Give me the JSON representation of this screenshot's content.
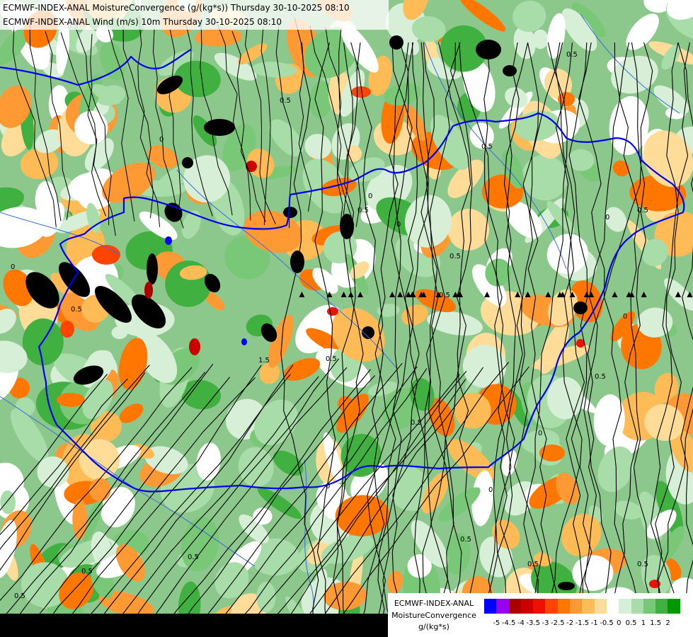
{
  "header": {
    "line1": "ECMWF-INDEX-ANAL MoistureConvergence (g/(kg*s)) Thursday 30-10-2025 08:10",
    "line2": "ECMWF-INDEX-ANAL Wind (m/s) 10m Thursday 30-10-2025 08:10"
  },
  "legend": {
    "line1": "ECMWF-INDEX-ANAL",
    "line2": "MoistureConvergence",
    "line3": "g/(kg*s)",
    "colors": [
      "#0000ff",
      "#9900ee",
      "#aa0000",
      "#cc0000",
      "#ee1100",
      "#ff4400",
      "#ff7700",
      "#ff9933",
      "#ffbb55",
      "#ffdd99",
      "#ffffff",
      "#d6efd6",
      "#a8dca8",
      "#78c878",
      "#40b040",
      "#009900"
    ],
    "ticks": [
      "-5",
      "-4.5",
      "-4",
      "-3.5",
      "-3",
      "-2.5",
      "-2",
      "-1.5",
      "-1",
      "-0.5",
      "0",
      "0.5",
      "1",
      "1.5",
      "2"
    ]
  },
  "map": {
    "contour_labels": [
      "0.5",
      "0",
      "0.5",
      "0",
      "0.5",
      "0.5",
      "0",
      "0.5",
      "1.5",
      "0.5",
      "0",
      "0.5",
      "0",
      "0.5",
      "0.5",
      "0.5",
      "0",
      "0.5",
      "0.5",
      "0",
      "0.5",
      "0.5",
      "0",
      "0.5",
      "0.5",
      "0.5",
      "0",
      "0.5"
    ],
    "border_color": "#0000ee",
    "river_color": "#3a6adf"
  }
}
